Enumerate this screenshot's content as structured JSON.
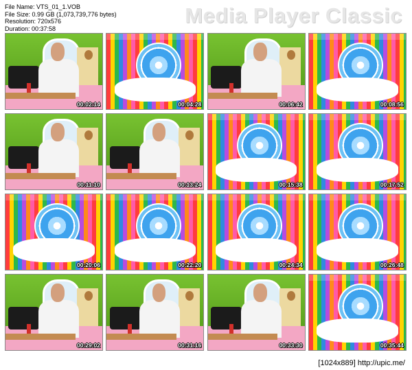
{
  "file_info": {
    "name_line": "File Name: VTS_01_1.VOB",
    "size_line": "File Size: 0.99 GB (1,073,739,776 bytes)",
    "resolution_line": "Resolution: 720x576",
    "duration_line": "Duration: 00:37:58"
  },
  "watermark": "Media Player Classic",
  "thumbnails": [
    {
      "time": "00:02:14",
      "scene": "studio"
    },
    {
      "time": "00:04:28",
      "scene": "cartoon"
    },
    {
      "time": "00:06:42",
      "scene": "studio"
    },
    {
      "time": "00:08:56",
      "scene": "cartoon"
    },
    {
      "time": "00:11:10",
      "scene": "studio"
    },
    {
      "time": "00:13:24",
      "scene": "studio"
    },
    {
      "time": "00:15:38",
      "scene": "cartoon"
    },
    {
      "time": "00:17:52",
      "scene": "cartoon"
    },
    {
      "time": "00:20:06",
      "scene": "cartoon"
    },
    {
      "time": "00:22:20",
      "scene": "cartoon"
    },
    {
      "time": "00:24:34",
      "scene": "cartoon"
    },
    {
      "time": "00:26:48",
      "scene": "cartoon"
    },
    {
      "time": "00:29:02",
      "scene": "studio"
    },
    {
      "time": "00:31:16",
      "scene": "studio"
    },
    {
      "time": "00:33:30",
      "scene": "studio"
    },
    {
      "time": "00:35:44",
      "scene": "cartoon"
    }
  ],
  "footer": "[1024x889] http://upic.me/"
}
